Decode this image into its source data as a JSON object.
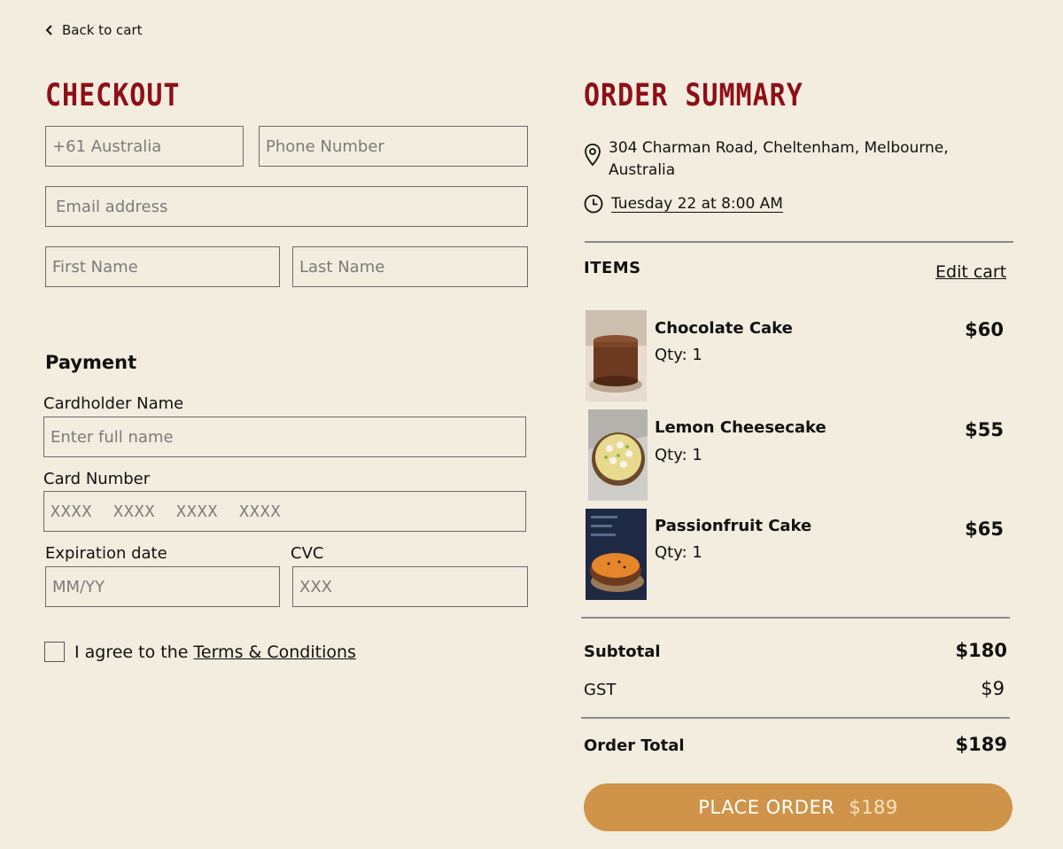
{
  "theme": {
    "brand": "#8e0f16",
    "accent": "#cf9449"
  },
  "nav": {
    "back_label": "Back to cart"
  },
  "checkout": {
    "title": "CHECKOUT",
    "country_placeholder": "+61 Australia",
    "phone_placeholder": "Phone Number",
    "email_placeholder": "Email address",
    "first_name_placeholder": "First Name",
    "last_name_placeholder": "Last Name"
  },
  "payment": {
    "title": "Payment",
    "cardholder_label": "Cardholder Name",
    "cardholder_placeholder": "Enter full name",
    "card_number_label": "Card Number",
    "card_number_placeholder": "XXXX  XXXX  XXXX  XXXX",
    "expiry_label": "Expiration date",
    "expiry_placeholder": "MM/YY",
    "cvc_label": "CVC",
    "cvc_placeholder": "XXX"
  },
  "terms": {
    "prefix": "I agree to the",
    "link": "Terms & Conditions"
  },
  "summary": {
    "title": "ORDER  SUMMARY",
    "address": "304 Charman Road, Cheltenham, Melbourne, Australia",
    "pickup_time": "Tuesday 22  at 8:00 AM",
    "items_label": "ITEMS",
    "edit_cart": "Edit cart",
    "items": [
      {
        "name": "Chocolate Cake",
        "qty": "Qty: 1",
        "price": "$60"
      },
      {
        "name": "Lemon Cheesecake",
        "qty": "Qty: 1",
        "price": "$55"
      },
      {
        "name": "Passionfruit Cake",
        "qty": "Qty: 1",
        "price": "$65"
      }
    ],
    "subtotal_label": "Subtotal",
    "subtotal_value": "$180",
    "gst_label": "GST",
    "gst_value": "$9",
    "total_label": "Order Total",
    "total_value": "$189",
    "place_order_label": "PLACE ORDER",
    "place_order_amount": "$189"
  }
}
